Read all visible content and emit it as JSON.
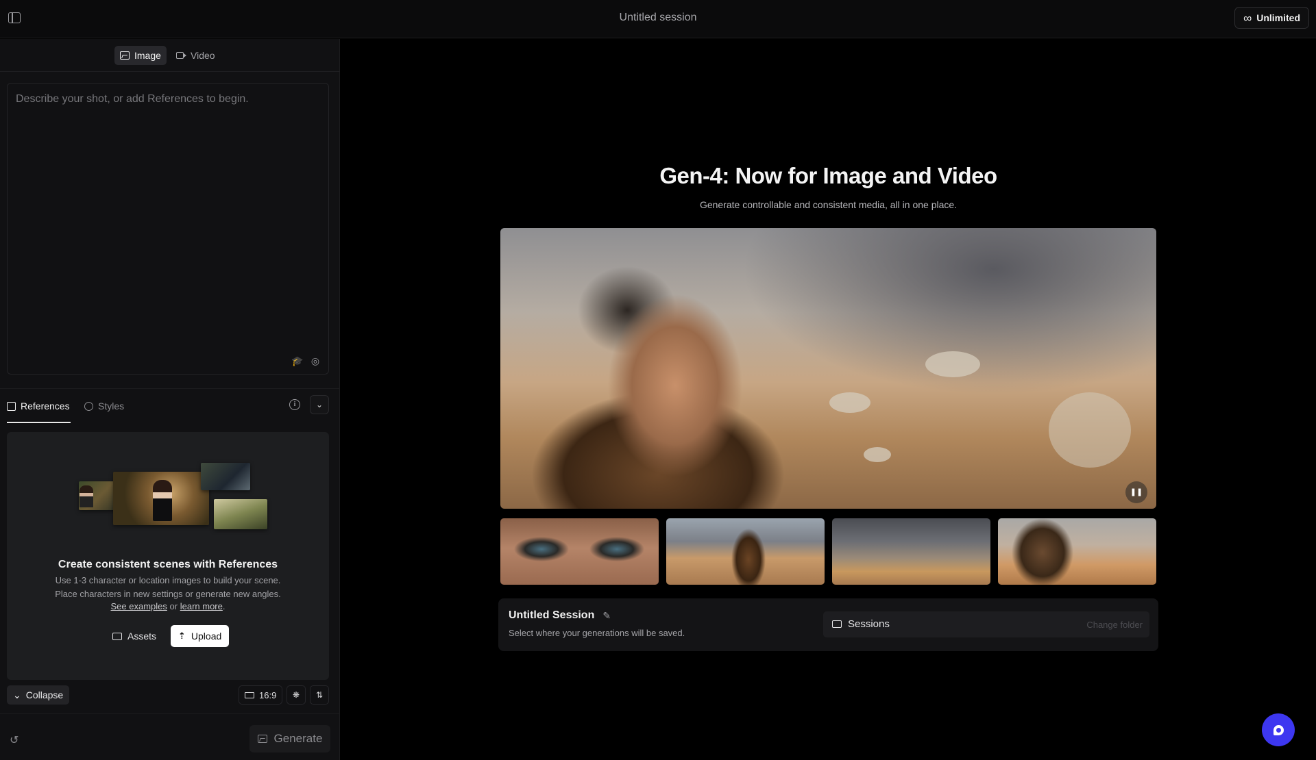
{
  "header": {
    "title": "Untitled session",
    "plan_label": "Unlimited",
    "plan_icon": "infinity-icon"
  },
  "left_panel": {
    "mode_tabs": [
      {
        "label": "Image",
        "icon": "image-icon",
        "active": true
      },
      {
        "label": "Video",
        "icon": "video-icon",
        "active": false
      }
    ],
    "prompt": {
      "value": "",
      "placeholder": "Describe your shot, or add References to begin."
    },
    "ref_tabs": [
      {
        "label": "References",
        "icon": "references-icon",
        "active": true
      },
      {
        "label": "Styles",
        "icon": "palette-icon",
        "active": false
      }
    ],
    "references_card": {
      "title": "Create consistent scenes with References",
      "line1": "Use 1-3 character or location images to build your scene.",
      "line2": "Place characters in new settings or generate new angles.",
      "link_examples": "See examples",
      "link_or": "or",
      "link_learn": "learn more",
      "link_end": ".",
      "assets_label": "Assets",
      "upload_label": "Upload"
    },
    "collapse_label": "Collapse",
    "aspect_ratio": "16:9",
    "generate_label": "Generate"
  },
  "main": {
    "title": "Gen-4: Now for Image and Video",
    "subtitle": "Generate controllable and consistent media, all in one place.",
    "session": {
      "name": "Untitled Session",
      "hint": "Select where your generations will be saved.",
      "folder": "Sessions",
      "change_folder": "Change folder"
    }
  },
  "colors": {
    "background": "#000000",
    "panel": "#111113",
    "accent_fab": "#3d37f0"
  }
}
